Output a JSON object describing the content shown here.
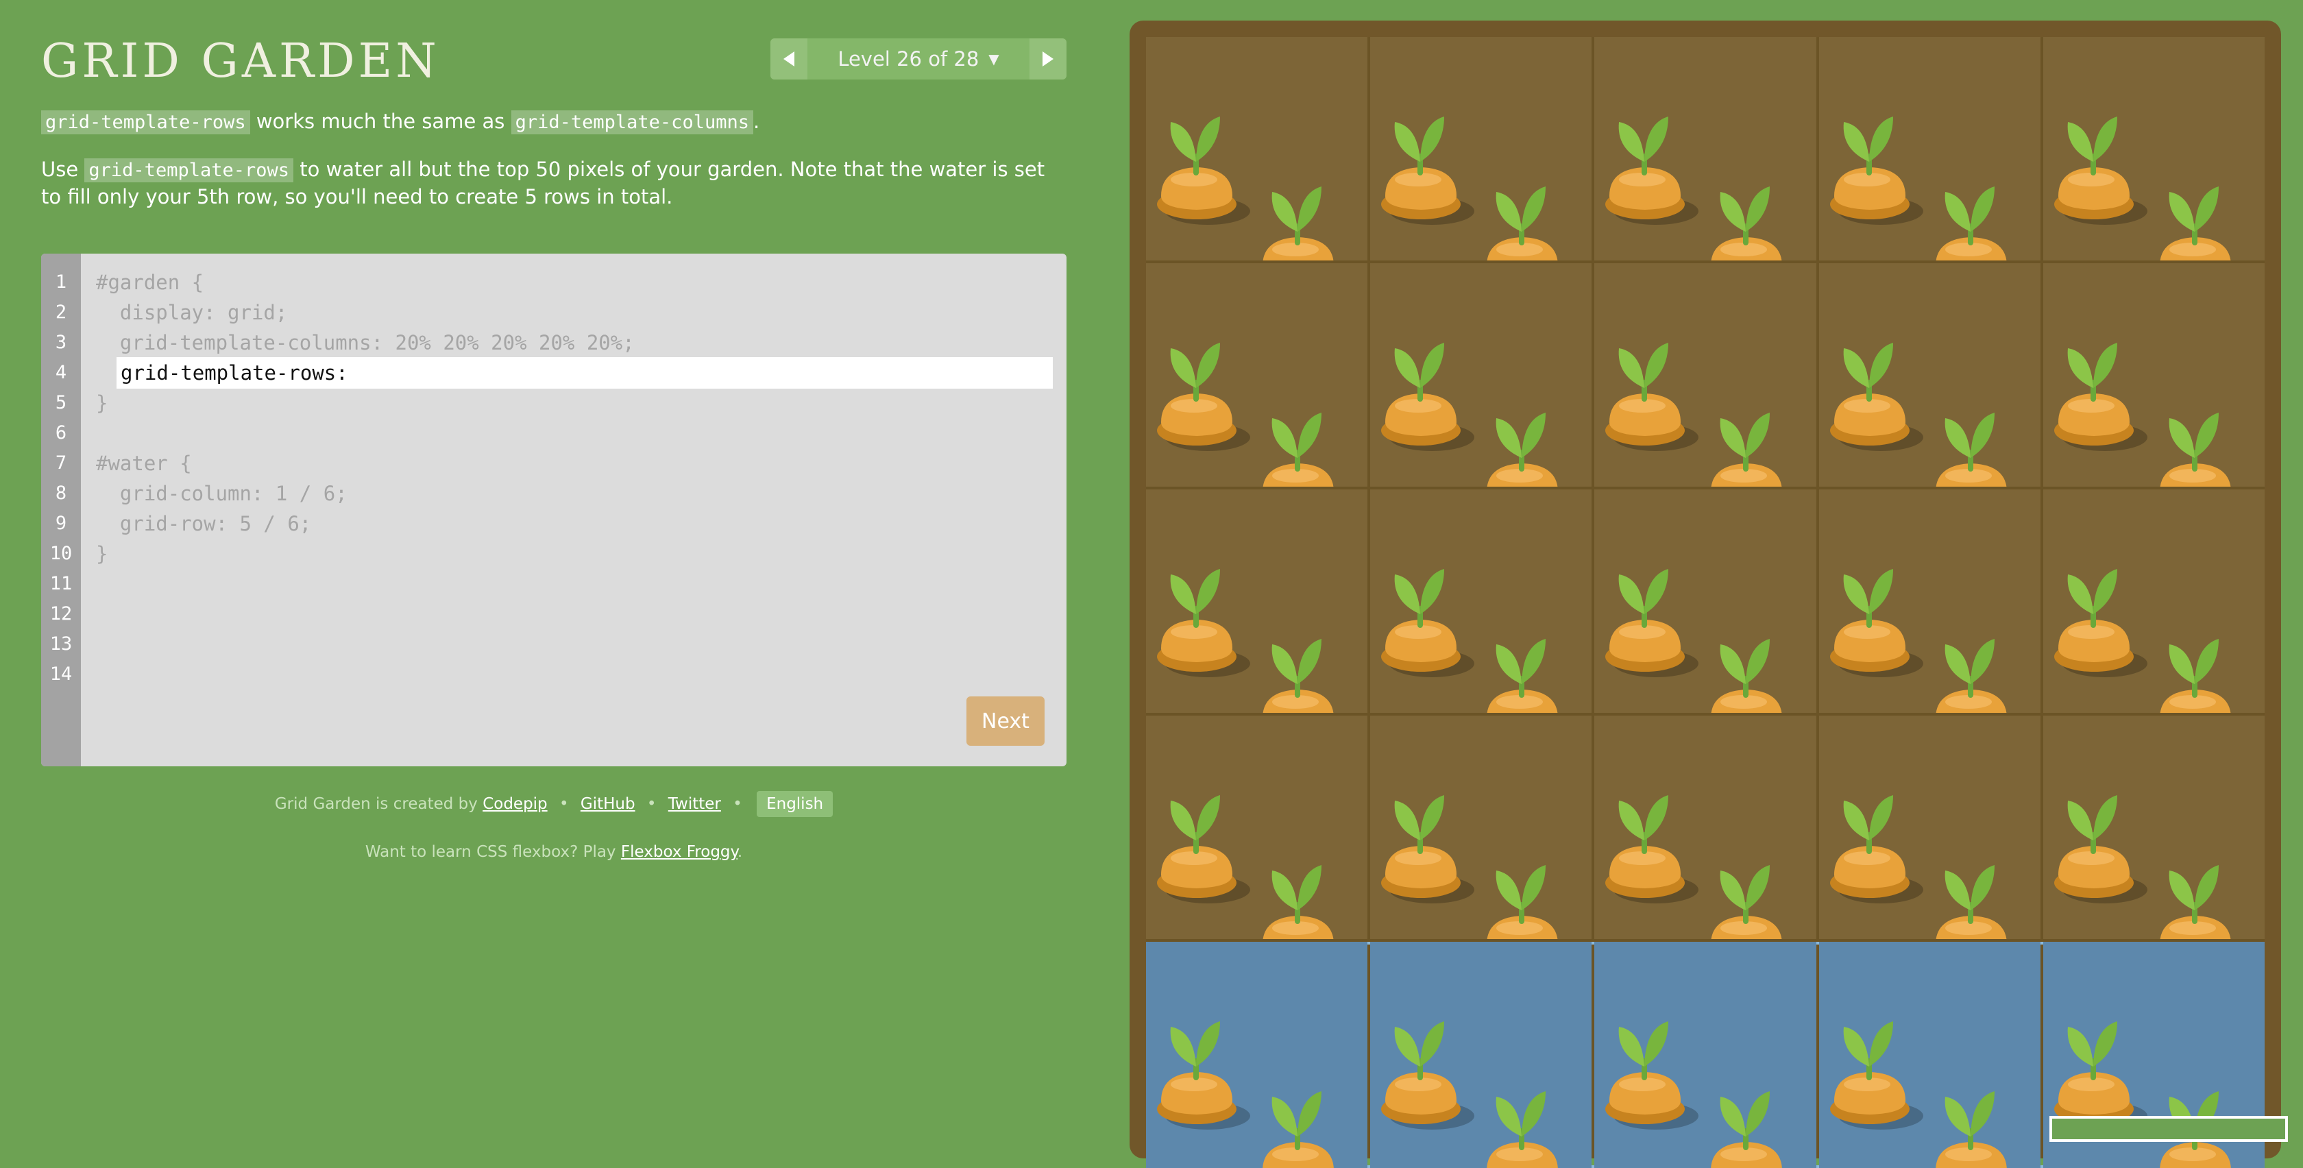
{
  "app": {
    "title": "GRID GARDEN"
  },
  "level_nav": {
    "label": "Level 26 of 28",
    "prev_icon": "triangle-left-icon",
    "next_icon": "triangle-right-icon"
  },
  "instructions": {
    "p1": {
      "code1": "grid-template-rows",
      "text1": " works much the same as ",
      "code2": "grid-template-columns",
      "text2": "."
    },
    "p2": {
      "text1": "Use ",
      "code1": "grid-template-rows",
      "text2": " to water all but the top 50 pixels of your garden. Note that the water is set to fill only your 5th row, so you'll need to create 5 rows in total."
    }
  },
  "editor": {
    "line_numbers": [
      "1",
      "2",
      "3",
      "4",
      "5",
      "6",
      "7",
      "8",
      "9",
      "10",
      "11",
      "12",
      "13",
      "14"
    ],
    "lines": {
      "l1": "#garden {",
      "l2": "  display: grid;",
      "l3": "  grid-template-columns: 20% 20% 20% 20% 20%;",
      "l4_prefix": " ",
      "l5": "}",
      "l7": "#water {",
      "l8": "  grid-column: 1 / 6;",
      "l9": "  grid-row: 5 / 6;",
      "l10": "}"
    },
    "input_value": "grid-template-rows:",
    "next_label": "Next"
  },
  "footer": {
    "created_by": "Grid Garden is created by",
    "codepip": "Codepip",
    "github": "GitHub",
    "twitter": "Twitter",
    "separator": "•",
    "language": "English",
    "learn_text": "Want to learn CSS flexbox? Play",
    "flexbox_froggy": "Flexbox Froggy",
    "period": "."
  },
  "garden": {
    "columns": 5,
    "dry_rows": 4,
    "wet_row": 5,
    "colors": {
      "soil": "#7d6537",
      "water": "#5d88ac",
      "carrot": "#e8a23a",
      "leaf": "#8cc548"
    }
  }
}
